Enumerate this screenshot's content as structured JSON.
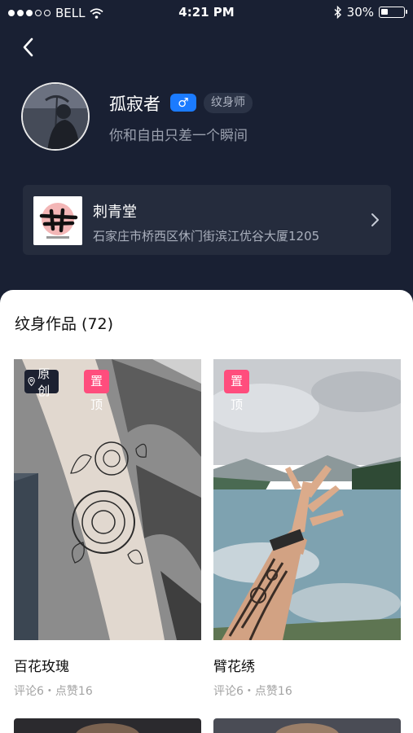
{
  "status_bar": {
    "carrier": "BELL",
    "time": "4:21 PM",
    "battery": "30%"
  },
  "profile": {
    "name": "孤寂者",
    "gender_symbol": "♂",
    "role": "纹身师",
    "bio": "你和自由只差一个瞬间"
  },
  "shop": {
    "name": "刺青堂",
    "address": "石家庄市桥西区休门街滨江优谷大厦1205"
  },
  "works": {
    "section_title": "纹身作品 (72)",
    "items": [
      {
        "title": "百花玫瑰",
        "meta": "评论6・点赞16",
        "badge_original": "原创",
        "badge_pinned": "置顶"
      },
      {
        "title": "臂花绣",
        "meta": "评论6・点赞16",
        "badge_pinned": "置顶"
      }
    ]
  },
  "colors": {
    "header_bg": "#192033",
    "gender_badge": "#1b7bff",
    "pinned_badge": "#ff4d7d"
  }
}
